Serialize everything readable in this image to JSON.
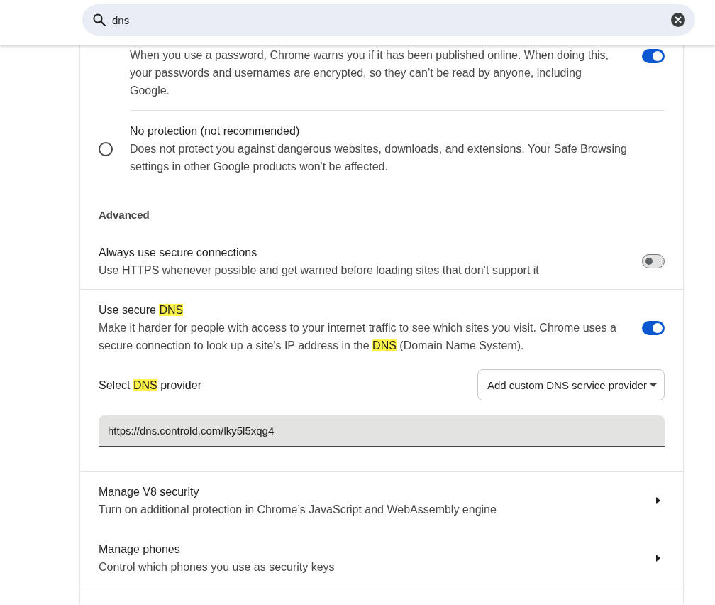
{
  "search": {
    "value": "dns"
  },
  "protection_options": [
    {
      "kind": "toggle",
      "description": [
        {
          "text": "When you use a password, Chrome warns you if it has been published online. When doing this, your passwords and usernames are encrypted, so they can’t be read by anyone, including Google.",
          "highlighted": false
        }
      ],
      "on": true
    },
    {
      "kind": "radio",
      "title": [
        {
          "text": "No protection (not recommended)",
          "highlighted": false
        }
      ],
      "description": [
        {
          "text": "Does not protect you against dangerous websites, downloads, and extensions. Your Safe Browsing settings in other Google products won't be affected.",
          "highlighted": false
        }
      ],
      "selected": false
    }
  ],
  "advanced": {
    "heading": "Advanced",
    "rows": [
      {
        "kind": "toggle",
        "title": [
          {
            "text": "Always use secure connections",
            "highlighted": false
          }
        ],
        "description": [
          {
            "text": "Use HTTPS whenever possible and get warned before loading sites that don’t support it",
            "highlighted": false
          }
        ],
        "on": false
      },
      {
        "kind": "toggle",
        "title": [
          {
            "text": "Use secure ",
            "highlighted": false
          },
          {
            "text": "DNS",
            "highlighted": true
          }
        ],
        "description": [
          {
            "text": "Make it harder for people with access to your internet traffic to see which sites you visit. Chrome uses a secure connection to look up a site's IP address in the ",
            "highlighted": false
          },
          {
            "text": "DNS",
            "highlighted": true
          },
          {
            "text": " (Domain Name System).",
            "highlighted": false
          }
        ],
        "on": true
      },
      {
        "kind": "select",
        "label": [
          {
            "text": "Select ",
            "highlighted": false
          },
          {
            "text": "DNS",
            "highlighted": true
          },
          {
            "text": " provider",
            "highlighted": false
          }
        ],
        "dropdown": "Add custom DNS service provider",
        "input_value": "https://dns.controld.com/lky5l5xqg4"
      },
      {
        "kind": "link",
        "title": [
          {
            "text": "Manage V8 security",
            "highlighted": false
          }
        ],
        "description": [
          {
            "text": "Turn on additional protection in Chrome’s JavaScript and WebAssembly engine",
            "highlighted": false
          }
        ]
      },
      {
        "kind": "link",
        "title": [
          {
            "text": "Manage phones",
            "highlighted": false
          }
        ],
        "description": [
          {
            "text": "Control which phones you use as security keys",
            "highlighted": false
          }
        ]
      }
    ]
  }
}
